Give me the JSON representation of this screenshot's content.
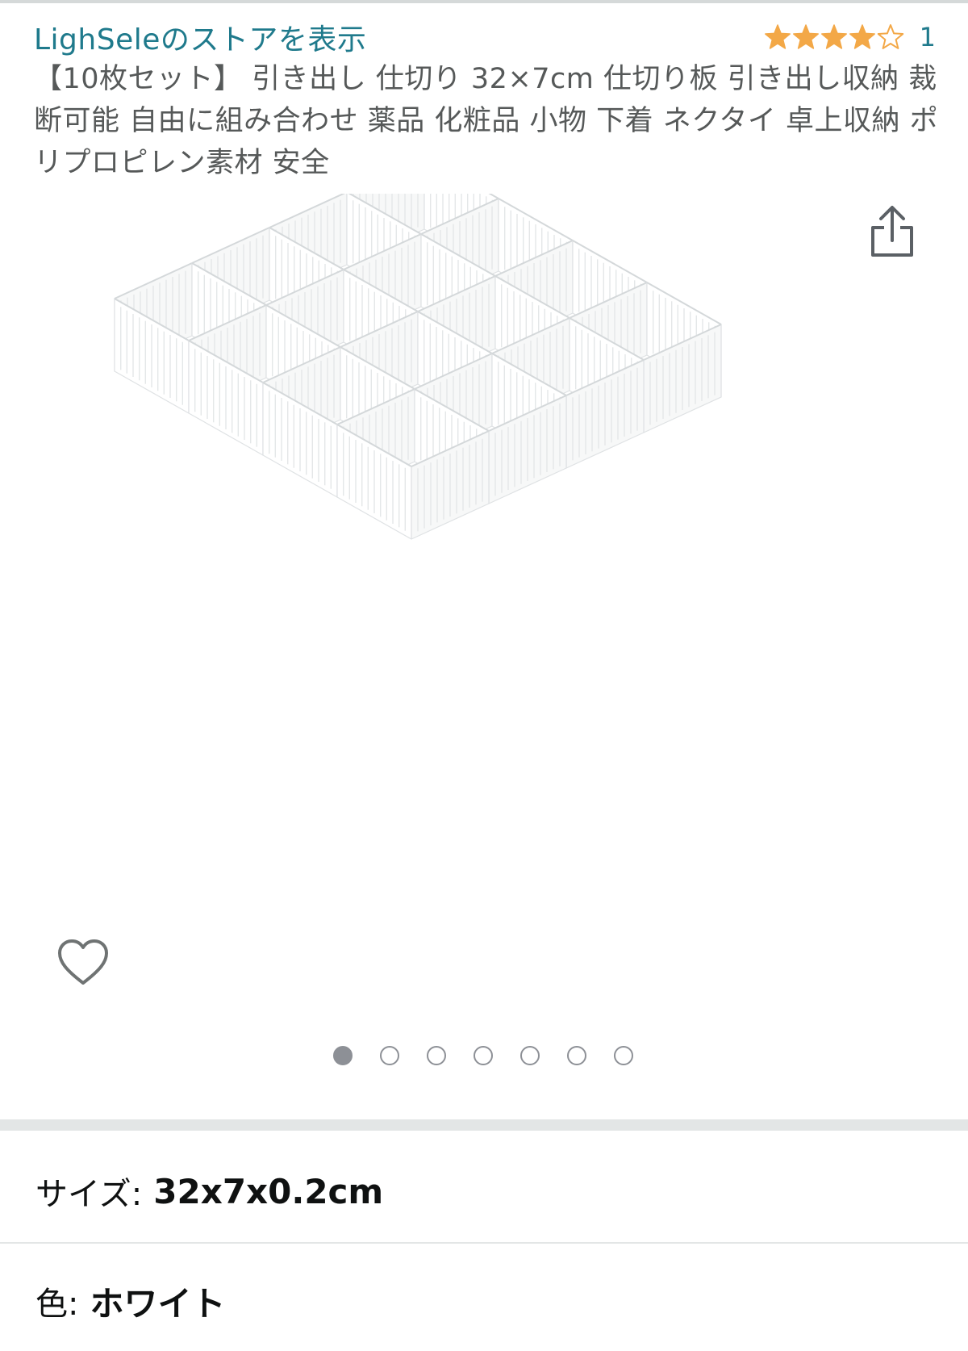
{
  "store": {
    "link_text": "LighSeleのストアを表示"
  },
  "rating": {
    "stars": 4,
    "max_stars": 5,
    "count": "1",
    "star_color": "#f3a847"
  },
  "product": {
    "title": "【10枚セット】 引き出し 仕切り 32×7cm 仕切り板 引き出し収納 裁断可能 自由に組み合わせ 薬品 化粧品 小物 下着 ネクタイ 卓上収納 ポリプロピレン素材 安全",
    "image_icon": "white-drawer-divider-grid"
  },
  "actions": {
    "share_icon": "share-icon",
    "wishlist_icon": "heart-outline-icon"
  },
  "gallery": {
    "total_images": 7,
    "current_index": 1
  },
  "variations": {
    "size_label": "サイズ:",
    "size_value": "32x7x0.2cm",
    "color_label": "色:",
    "color_value": "ホワイト"
  },
  "colors": {
    "link": "#1f7a8c",
    "star": "#f3a847",
    "muted_text": "#565959",
    "dot": "#8d9096",
    "divider": "#e3e6e6"
  }
}
